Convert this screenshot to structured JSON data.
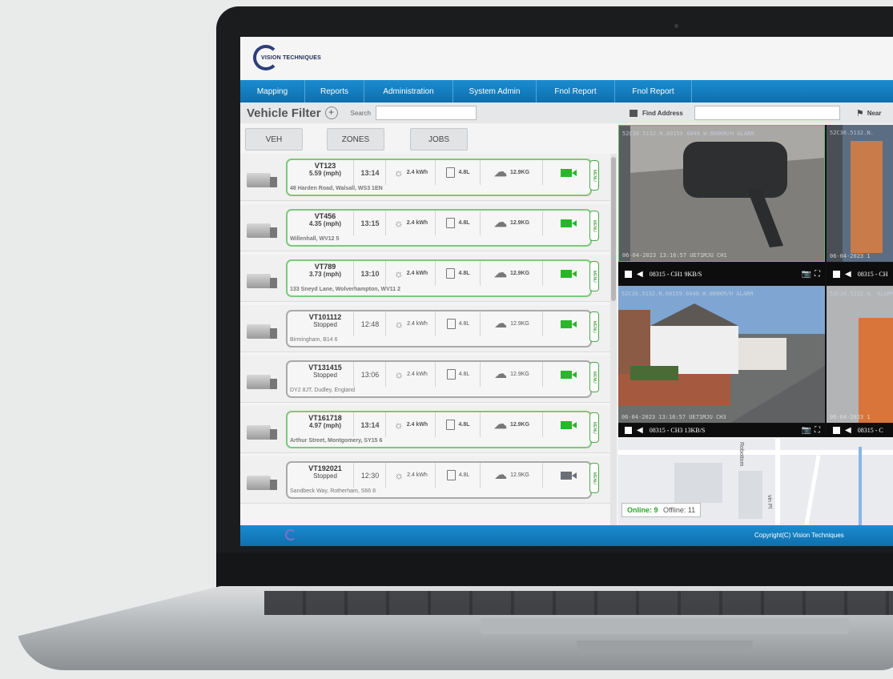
{
  "app": {
    "logo_text": "VISION TECHNIQUES",
    "nav": [
      "Mapping",
      "Reports",
      "Administration",
      "System Admin",
      "Fnol Report",
      "Fnol Report"
    ],
    "footer_copyright": "Copyright(C) Vision Techniques"
  },
  "vehicle_filter": {
    "title": "Vehicle Filter",
    "search_label": "Search",
    "search_value": "",
    "buttons": [
      "VEH",
      "ZONES",
      "JOBS"
    ]
  },
  "vehicles": [
    {
      "id": "VT123",
      "speed": "5.59 (mph)",
      "time": "13:14",
      "solar": "2.4 kWh",
      "fuel": "4.8L",
      "co2": "12.9KG",
      "address": "48 Harden Road, Walsall, WS3 1EN",
      "online": true
    },
    {
      "id": "VT456",
      "speed": "4.35 (mph)",
      "time": "13:15",
      "solar": "2.4 kWh",
      "fuel": "4.8L",
      "co2": "12.9KG",
      "address": "Willenhall, WV12 5",
      "online": true
    },
    {
      "id": "VT789",
      "speed": "3.73 (mph)",
      "time": "13:10",
      "solar": "2.4 kWh",
      "fuel": "4.8L",
      "co2": "12.9KG",
      "address": "133 Sneyd Lane, Wolverhampton, WV11 2",
      "online": true
    },
    {
      "id": "VT101112",
      "speed": "Stopped",
      "time": "12:48",
      "solar": "2.4 kWh",
      "fuel": "4.8L",
      "co2": "12.9KG",
      "address": "Birmingham, B14 6",
      "online": false
    },
    {
      "id": "VT131415",
      "speed": "Stopped",
      "time": "13:06",
      "solar": "2.4 kWh",
      "fuel": "4.8L",
      "co2": "12.9KG",
      "address": "DY2 8JT, Dudley, England",
      "online": false
    },
    {
      "id": "VT161718",
      "speed": "4.97 (mph)",
      "time": "13:14",
      "solar": "2.4 kWh",
      "fuel": "4.8L",
      "co2": "12.9KG",
      "address": "Arthur Street, Montgomery, SY15 6",
      "online": true
    },
    {
      "id": "VT192021",
      "speed": "Stopped",
      "time": "12:30",
      "solar": "2.4 kWh",
      "fuel": "4.8L",
      "co2": "12.9KG",
      "address": "Sandbeck Way, Rotherham, S66 8",
      "online": false
    }
  ],
  "menu_tab_label": "MENU",
  "find_address": {
    "label": "Find Address",
    "value": "",
    "near_label": "Near"
  },
  "cameras": [
    {
      "overlay": "52C36.5132.N.00159.6040.W.000KM/H ALARM",
      "timestamp": "06-04-2023 13:16:57 UE71MJU CH1",
      "bar_label": "08315 - CH1 9KB/S"
    },
    {
      "overlay": "52C36.5132.N.",
      "timestamp": "06-04-2023 1",
      "bar_label": "08315 - CH"
    },
    {
      "overlay": "52C36.5132.N.00159.6040.W.000KM/H ALARM",
      "timestamp": "06-04-2023 13:16:57 UE71MJU CH3",
      "bar_label": "08315 - CH3 13KB/S"
    },
    {
      "overlay": "52C36.5132.N. ALARM",
      "timestamp": "06-04-2023 1",
      "bar_label": "08315 - C"
    }
  ],
  "map": {
    "street_1": "Robottom",
    "street_2": "vin Pl"
  },
  "status": {
    "online": "Online: 9",
    "offline": "Offline: 11"
  },
  "colors": {
    "nav_blue": "#1a8ccf",
    "online_green": "#2bb52b",
    "offline_grey": "#6b6f78"
  }
}
